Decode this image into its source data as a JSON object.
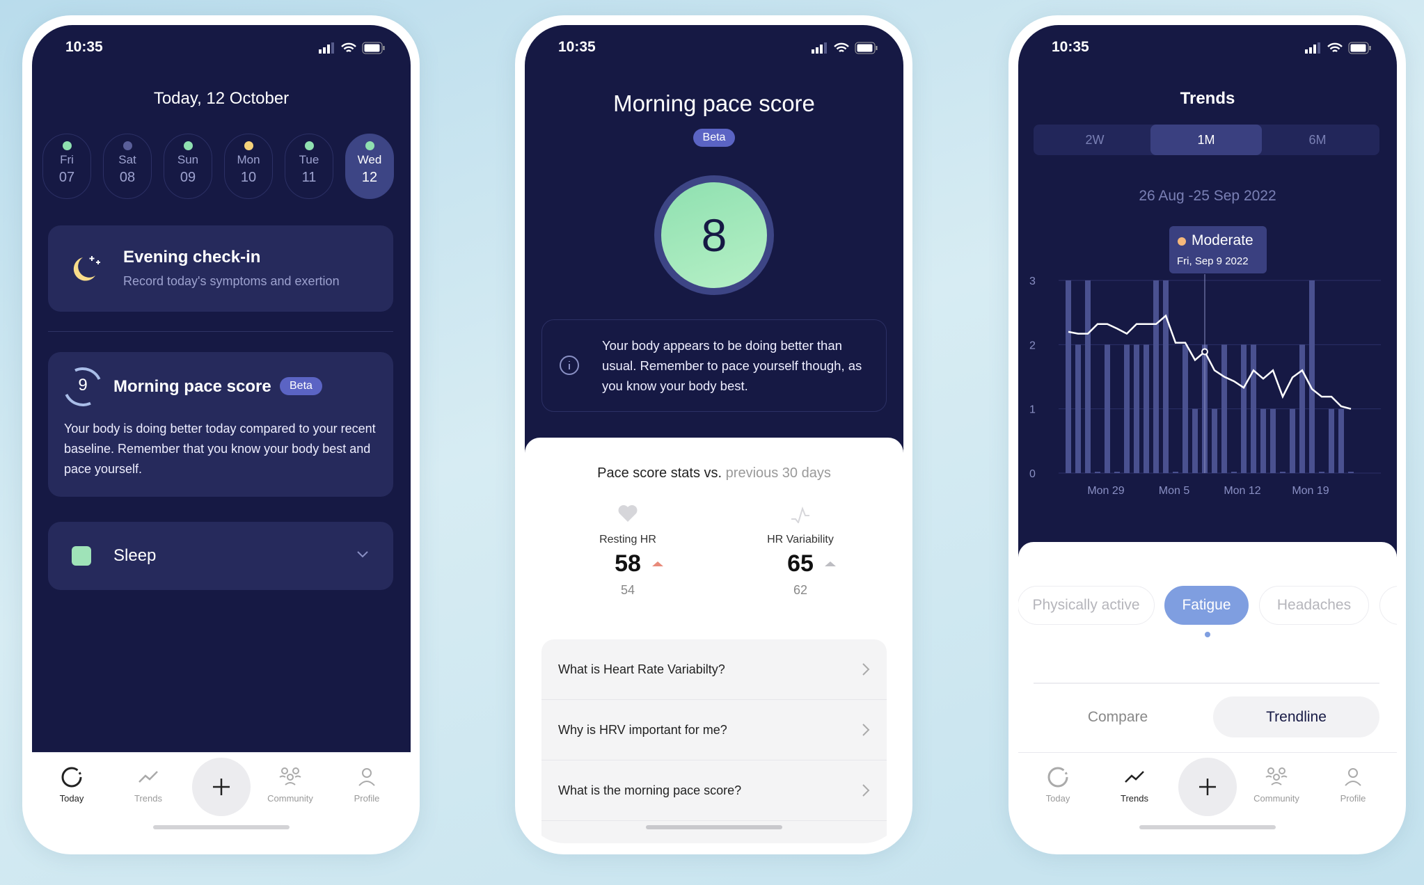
{
  "status_bar": {
    "time": "10:35"
  },
  "nav": {
    "items": [
      {
        "label": "Today",
        "icon": "today-ring-icon"
      },
      {
        "label": "Trends",
        "icon": "trend-line-icon"
      },
      {
        "label": "Community",
        "icon": "community-icon"
      },
      {
        "label": "Profile",
        "icon": "profile-icon"
      }
    ],
    "add_icon": "plus-icon"
  },
  "today": {
    "title": "Today, 12 October",
    "days": [
      {
        "name": "Fri",
        "date": "07",
        "dot": "#8fe0b0"
      },
      {
        "name": "Sat",
        "date": "08",
        "dot": "#5a5f9a"
      },
      {
        "name": "Sun",
        "date": "09",
        "dot": "#8fe0b0"
      },
      {
        "name": "Mon",
        "date": "10",
        "dot": "#f5d27a"
      },
      {
        "name": "Tue",
        "date": "11",
        "dot": "#8fe0b0"
      },
      {
        "name": "Wed",
        "date": "12",
        "dot": "#8fe0b0",
        "selected": true
      }
    ],
    "checkin": {
      "title": "Evening check-in",
      "subtitle": "Record today's symptoms and exertion"
    },
    "pace": {
      "score": "9",
      "title": "Morning pace score",
      "badge": "Beta",
      "text": "Your body is doing better today compared to your recent baseline. Remember that you know your body best and pace yourself."
    },
    "sleep": {
      "label": "Sleep",
      "color": "#9fe3b8"
    }
  },
  "pace_detail": {
    "title": "Morning pace score",
    "badge": "Beta",
    "score": "8",
    "info": "Your body appears to be doing better than usual. Remember to pace yourself though, as you know your body best.",
    "stats_heading": "Pace score stats vs.",
    "stats_heading_muted": "previous 30 days",
    "stats": [
      {
        "label": "Resting HR",
        "value": "58",
        "previous": "54",
        "trend": "up",
        "trend_color": "#e88a7a"
      },
      {
        "label": "HR Variability",
        "value": "65",
        "previous": "62",
        "trend": "up",
        "trend_color": "#bdbdc2"
      }
    ],
    "faq": [
      "What is Heart Rate Variabilty?",
      "Why is HRV important for me?",
      "What is the morning pace score?"
    ]
  },
  "trends": {
    "title": "Trends",
    "ranges": [
      {
        "label": "2W"
      },
      {
        "label": "1M",
        "selected": true
      },
      {
        "label": "6M"
      }
    ],
    "date_range": "26 Aug -25 Sep 2022",
    "tooltip": {
      "label": "Moderate",
      "date": "Fri, Sep 9 2022",
      "color": "#f5b87a"
    },
    "chips": [
      {
        "label": "Physically active"
      },
      {
        "label": "Fatigue",
        "selected": true
      },
      {
        "label": "Headaches"
      }
    ],
    "modes": [
      {
        "label": "Compare"
      },
      {
        "label": "Trendline",
        "selected": true
      }
    ]
  },
  "chart_data": {
    "type": "bar",
    "categories": [
      "Aug 26",
      "Aug 27",
      "Aug 28",
      "Aug 29",
      "Aug 30",
      "Aug 31",
      "Sep 1",
      "Sep 2",
      "Sep 3",
      "Sep 4",
      "Sep 5",
      "Sep 6",
      "Sep 7",
      "Sep 8",
      "Sep 9",
      "Sep 10",
      "Sep 11",
      "Sep 12",
      "Sep 13",
      "Sep 14",
      "Sep 15",
      "Sep 16",
      "Sep 17",
      "Sep 18",
      "Sep 19",
      "Sep 20",
      "Sep 21",
      "Sep 22",
      "Sep 23",
      "Sep 24"
    ],
    "series": [
      {
        "type": "bar",
        "values": [
          3,
          2,
          3,
          0,
          2,
          0,
          2,
          2,
          2,
          3,
          3,
          0,
          2,
          1,
          2,
          1,
          2,
          0,
          2,
          2,
          1,
          1,
          0,
          1,
          2,
          3,
          0,
          1,
          1,
          0
        ]
      },
      {
        "type": "line",
        "values": [
          2.2,
          2.17,
          2.17,
          2.32,
          2.32,
          2.25,
          2.17,
          2.32,
          2.32,
          2.32,
          2.45,
          2.03,
          2.03,
          1.76,
          1.89,
          1.6,
          1.5,
          1.43,
          1.33,
          1.6,
          1.47,
          1.6,
          1.19,
          1.49,
          1.6,
          1.31,
          1.19,
          1.19,
          1.04,
          1.0
        ]
      }
    ],
    "x_tick_labels": [
      "Mon 29",
      "Mon 5",
      "Mon 12",
      "Mon 19"
    ],
    "x_tick_categories": [
      "Aug 29",
      "Sep 5",
      "Sep 12",
      "Sep 19"
    ],
    "y_ticks": [
      0,
      1,
      2,
      3
    ],
    "ylim": [
      0,
      3
    ],
    "grid": true,
    "highlighted": "Sep 9",
    "bar_color": "#4a5190",
    "line_color": "#ffffff"
  }
}
